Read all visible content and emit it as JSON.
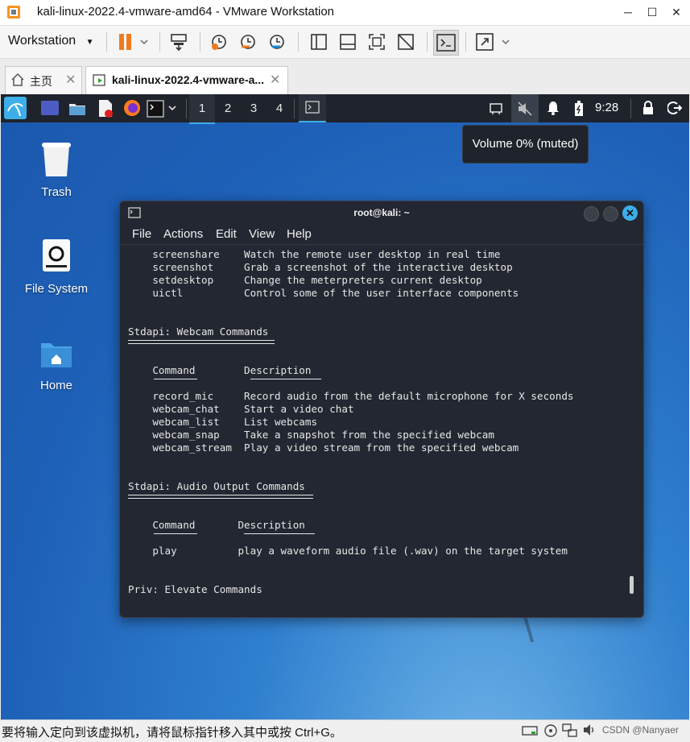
{
  "window": {
    "title": "kali-linux-2022.4-vmware-amd64 - VMware Workstation",
    "minimize_icon": "─",
    "maximize_icon": "☐",
    "close_icon": "✕"
  },
  "toolbar": {
    "menu_label": "Workstation"
  },
  "tabs": [
    {
      "label": "主页"
    },
    {
      "label": "kali-linux-2022.4-vmware-a..."
    }
  ],
  "guest": {
    "workspaces": [
      "1",
      "2",
      "3",
      "4"
    ],
    "clock": "9:28",
    "volume_tooltip": "Volume 0% (muted)",
    "desktop_icons": [
      {
        "label": "Trash"
      },
      {
        "label": "File System"
      },
      {
        "label": "Home"
      }
    ],
    "terminal": {
      "title": "root@kali: ~",
      "menu": [
        "File",
        "Actions",
        "Edit",
        "View",
        "Help"
      ],
      "lines": {
        "l1": "    screenshare    Watch the remote user desktop in real time",
        "l2": "    screenshot     Grab a screenshot of the interactive desktop",
        "l3": "    setdesktop     Change the meterpreters current desktop",
        "l4": "    uictl          Control some of the user interface components",
        "webcam_header": "Stdapi: Webcam Commands",
        "webcam_col": "    Command        Description",
        "w1": "    record_mic     Record audio from the default microphone for X seconds",
        "w2": "    webcam_chat    Start a video chat",
        "w3": "    webcam_list    List webcams",
        "w4": "    webcam_snap    Take a snapshot from the specified webcam",
        "w5": "    webcam_stream  Play a video stream from the specified webcam",
        "audio_header": "Stdapi: Audio Output Commands",
        "audio_col": "    Command       Description",
        "a1": "    play          play a waveform audio file (.wav) on the target system",
        "priv_header": "Priv: Elevate Commands"
      }
    }
  },
  "statusbar": {
    "message": "要将输入定向到该虚拟机，请将鼠标指针移入其中或按 Ctrl+G。",
    "watermark": "CSDN @Nanyaer"
  },
  "colors": {
    "panel": "#1f232b",
    "terminal_bg": "#232731",
    "accent": "#3daee9",
    "pause_orange": "#f07b1f"
  }
}
